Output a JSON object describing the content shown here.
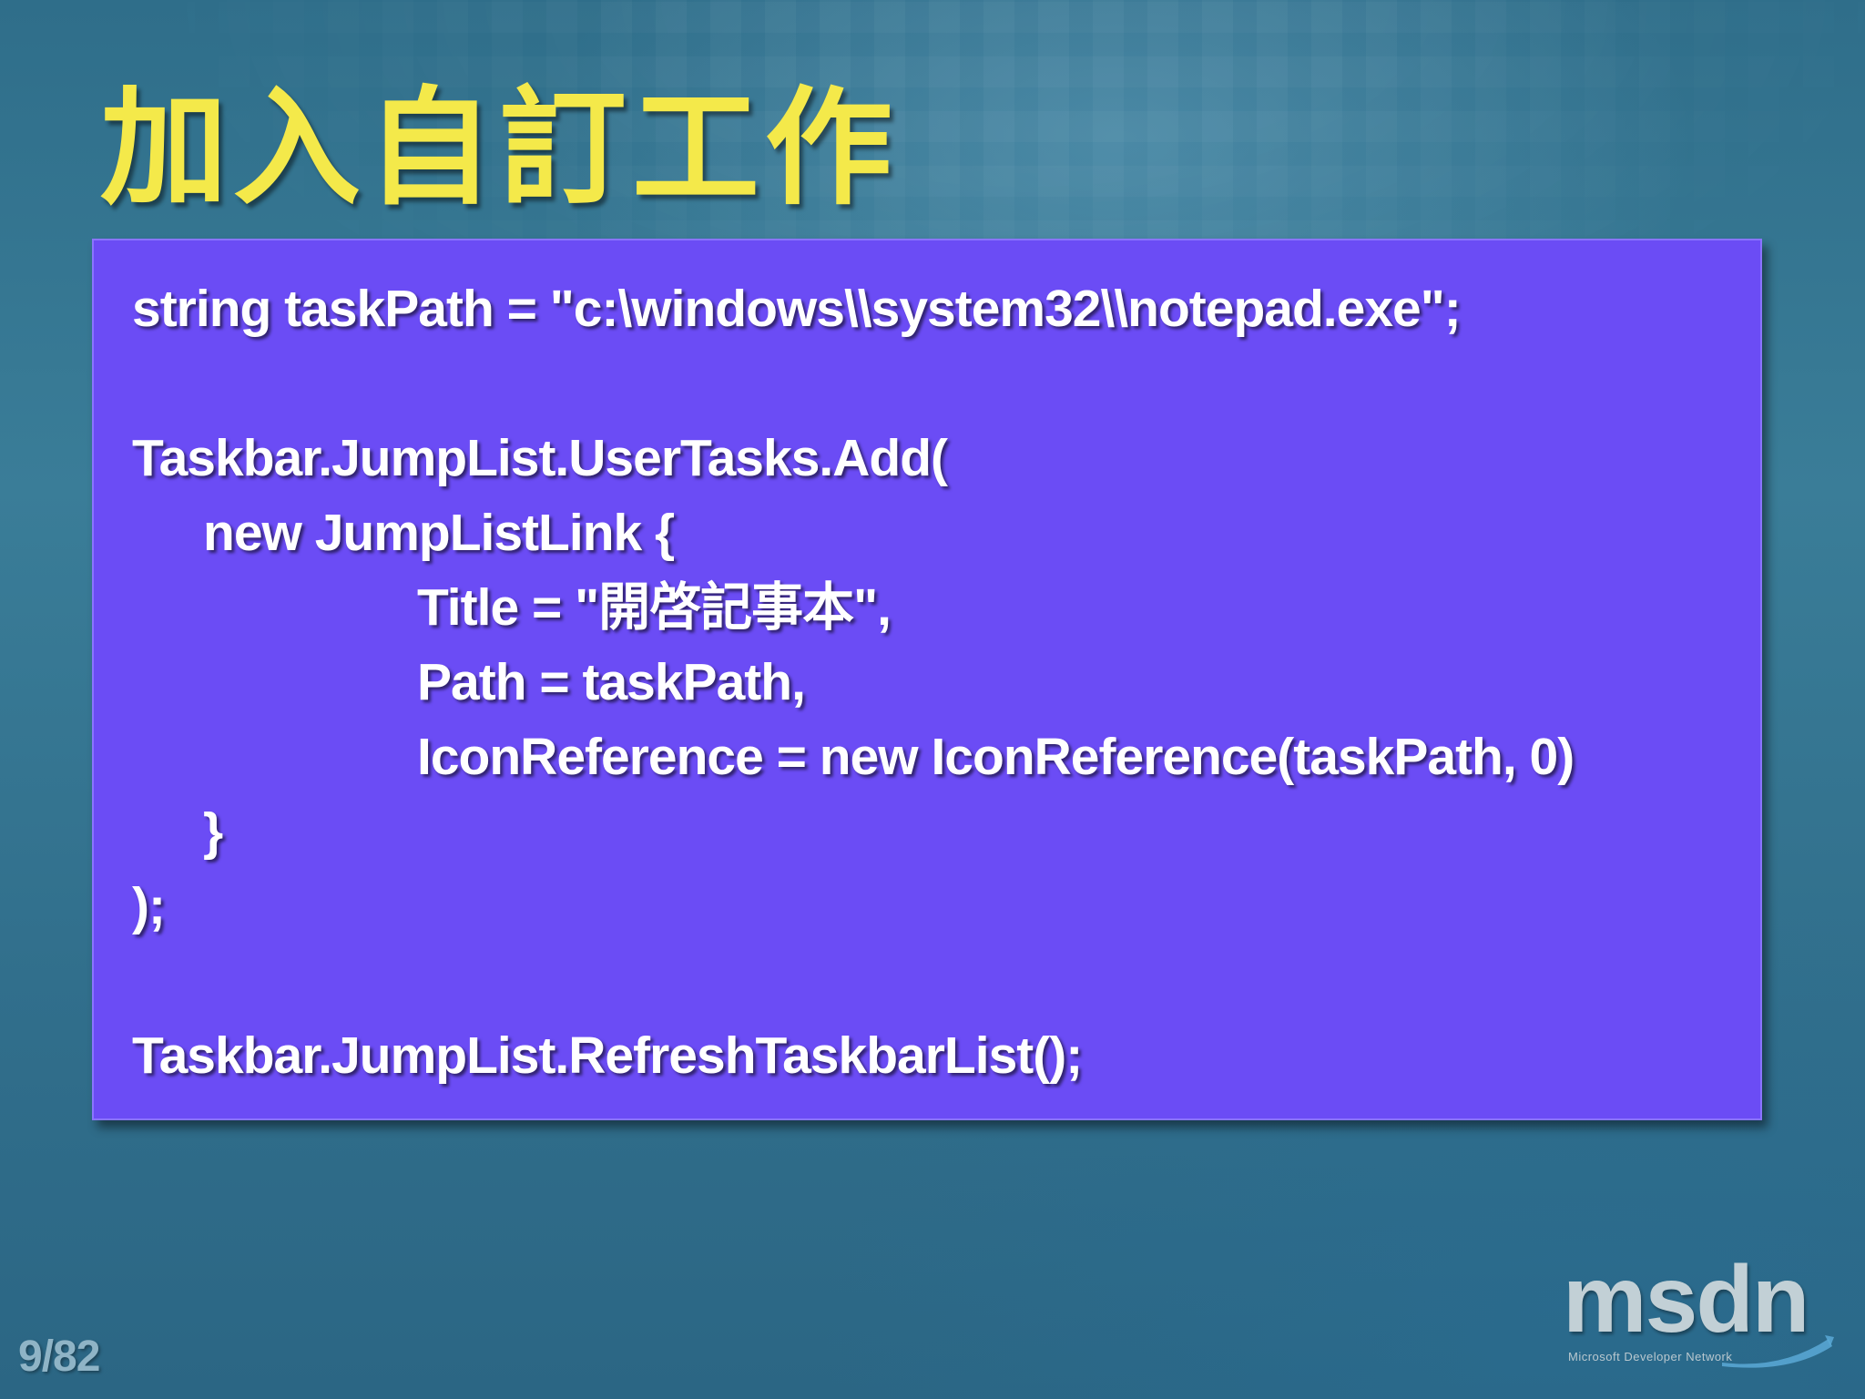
{
  "slide": {
    "title": "加入自訂工作",
    "page_number": "9/82"
  },
  "code": {
    "lines": [
      "string taskPath = \"c:\\windows\\\\system32\\\\notepad.exe\";",
      "",
      "Taskbar.JumpList.UserTasks.Add(",
      "new JumpListLink {",
      "Title = \"開啓記事本\",",
      "Path = taskPath,",
      "IconReference = new IconReference(taskPath, 0)",
      "}",
      ");",
      "",
      "Taskbar.JumpList.RefreshTaskbarList();"
    ]
  },
  "logo": {
    "word": "msdn",
    "subtitle": "Microsoft Developer Network"
  },
  "colors": {
    "title": "#f4e94a",
    "code_box": "#6b4cf5",
    "background": "#3a7d98"
  }
}
